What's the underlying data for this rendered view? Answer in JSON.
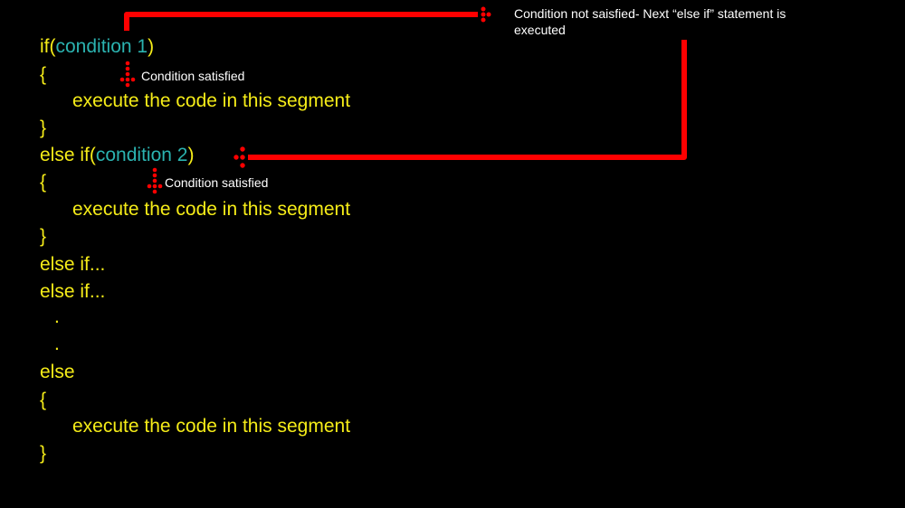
{
  "colors": {
    "background": "#000000",
    "code": "#f5ec18",
    "condition": "#2bb3b0",
    "arrow": "#ff0000",
    "annotation": "#ffffff"
  },
  "code": {
    "if_kw": "if(",
    "cond1": "condition 1",
    "close_paren_1": ")",
    "brace_open_1": "{",
    "body_1": "execute the code in this segment",
    "brace_close_1": "}",
    "elseif_kw": "else if(",
    "cond2": "condition 2",
    "close_paren_2": ")",
    "brace_open_2": "{",
    "body_2": "execute the code in this segment",
    "brace_close_2": "}",
    "elseif_more_1": "else if...",
    "elseif_more_2": "else if...",
    "dot_1": ".",
    "dot_2": ".",
    "else_kw": "else",
    "brace_open_3": "{",
    "body_3": "execute the code in this segment",
    "brace_close_3": "}"
  },
  "annotations": {
    "not_satisfied": "Condition not saisfied- Next “else if” statement is executed",
    "satisfied_1": "Condition satisfied",
    "satisfied_2": "Condition satisfied"
  }
}
